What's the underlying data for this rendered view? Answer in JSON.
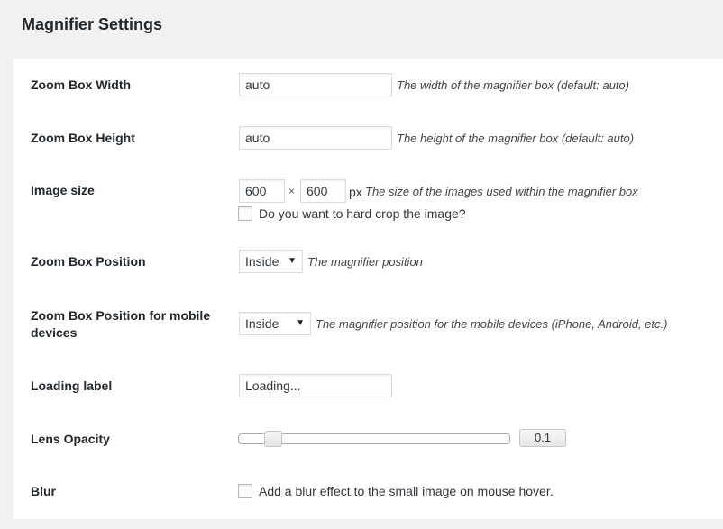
{
  "page": {
    "title": "Magnifier Settings"
  },
  "settings": {
    "zoom_width": {
      "label": "Zoom Box Width",
      "value": "auto",
      "description": "The width of the magnifier box (default: auto)"
    },
    "zoom_height": {
      "label": "Zoom Box Height",
      "value": "auto",
      "description": "The height of the magnifier box (default: auto)"
    },
    "image_size": {
      "label": "Image size",
      "width": "600",
      "height": "600",
      "separator": "×",
      "unit": "px",
      "description": "The size of the images used within the magnifier box",
      "crop_label": "Do you want to hard crop the image?",
      "crop_checked": false
    },
    "zoom_position": {
      "label": "Zoom Box Position",
      "selected": "Inside",
      "description": "The magnifier position"
    },
    "zoom_position_mobile": {
      "label": "Zoom Box Position for mobile devices",
      "selected": "Inside",
      "description": "The magnifier position for the mobile devices (iPhone, Android, etc.)"
    },
    "loading_label": {
      "label": "Loading label",
      "value": "Loading..."
    },
    "lens_opacity": {
      "label": "Lens Opacity",
      "value": "0.1",
      "level": 0.1
    },
    "blur": {
      "label": "Blur",
      "checkbox_label": "Add a blur effect to the small image on mouse hover.",
      "checked": false
    }
  },
  "icons": {
    "dropdown": "chevron-down-icon"
  }
}
